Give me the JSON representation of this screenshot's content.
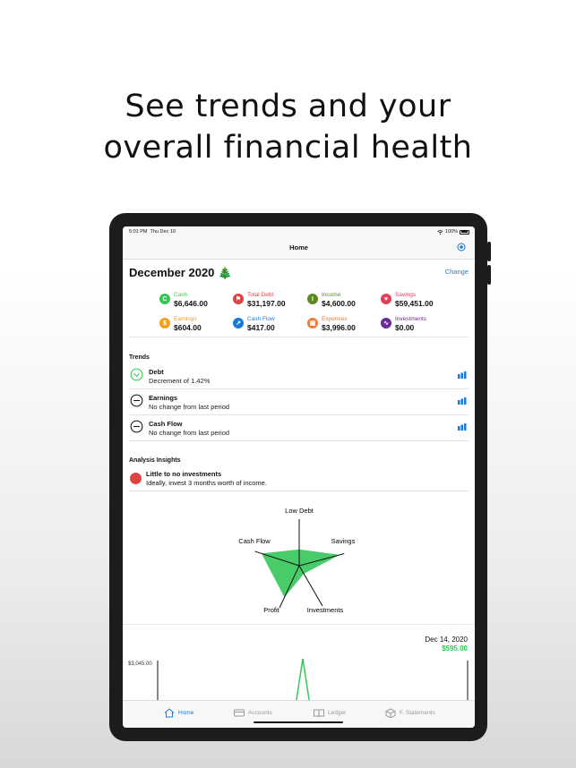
{
  "headline": [
    "See trends and your",
    "overall financial health"
  ],
  "status": {
    "time": "5:01 PM",
    "date": "Thu Dec 10",
    "battery": "100%"
  },
  "nav": {
    "title": "Home"
  },
  "period": {
    "title": "December 2020 🎄",
    "change": "Change"
  },
  "metrics": [
    {
      "label": "Cash",
      "value": "$6,646.00",
      "color": "#33c759",
      "glyph": "C"
    },
    {
      "label": "Total Debt",
      "value": "$31,197.00",
      "color": "#e04242",
      "glyph": "⚑"
    },
    {
      "label": "Income",
      "value": "$4,600.00",
      "color": "#5b8a1f",
      "glyph": "I"
    },
    {
      "label": "Savings",
      "value": "$59,451.00",
      "color": "#e0405a",
      "glyph": "♥"
    },
    {
      "label": "Earnings",
      "value": "$604.00",
      "color": "#f0a020",
      "glyph": "$"
    },
    {
      "label": "Cash Flow",
      "value": "$417.00",
      "color": "#1a7ad8",
      "glyph": "↗"
    },
    {
      "label": "Expenses",
      "value": "$3,996.00",
      "color": "#f07a3a",
      "glyph": "⊡"
    },
    {
      "label": "Investments",
      "value": "$0.00",
      "color": "#6a2a9a",
      "glyph": "∿"
    }
  ],
  "trends": {
    "title": "Trends",
    "items": [
      {
        "name": "Debt",
        "desc": "Decrement of 1.42%"
      },
      {
        "name": "Earnings",
        "desc": "No change from last period"
      },
      {
        "name": "Cash Flow",
        "desc": "No change from last period"
      }
    ]
  },
  "insights": {
    "title": "Analysis Insights",
    "item": {
      "name": "Little to no investments",
      "desc": "Ideally, invest 3 months worth of income."
    }
  },
  "radar": {
    "axes": [
      "Low Debt",
      "Savings",
      "Investments",
      "Profit",
      "Cash Flow"
    ],
    "values": [
      0.35,
      0.9,
      0.2,
      0.75,
      0.85
    ]
  },
  "graph": {
    "date": "Dec 14, 2020",
    "amount": "$595.00",
    "ylabel": "$3,045.00"
  },
  "tabs": [
    "Home",
    "Accounts",
    "Ledger",
    "F. Statements"
  ],
  "colors": {
    "accent": "#1a7ad8",
    "positive": "#33c759",
    "negative": "#e04242"
  }
}
